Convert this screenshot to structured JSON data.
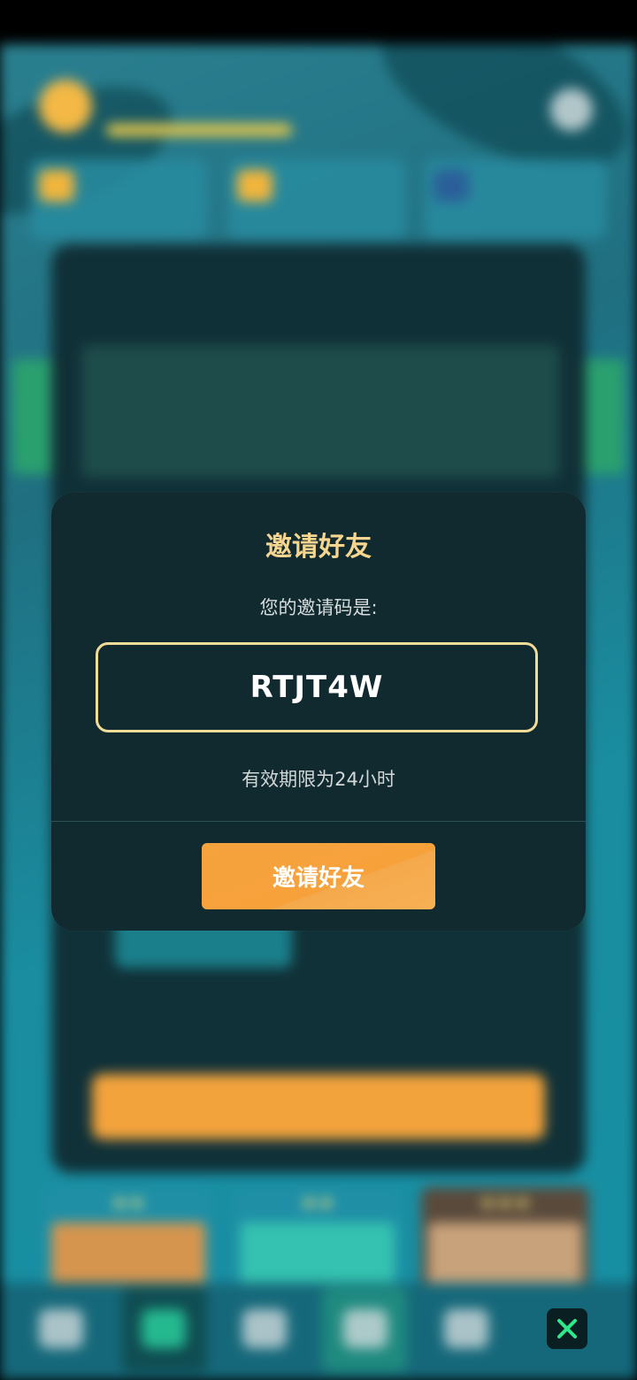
{
  "dialog": {
    "title": "邀请好友",
    "prompt": "您的邀请码是:",
    "invite_code": "RTJT4W",
    "validity_note": "有效期限为24小时",
    "invite_button_label": "邀请好友"
  },
  "controls": {
    "close_icon": "close-x-icon"
  },
  "colors": {
    "title": "#f6d58f",
    "code_border": "#f2dd98",
    "button": "#f6a33d",
    "modal_bg": "#112a2f",
    "close_icon": "#2ee88a"
  }
}
